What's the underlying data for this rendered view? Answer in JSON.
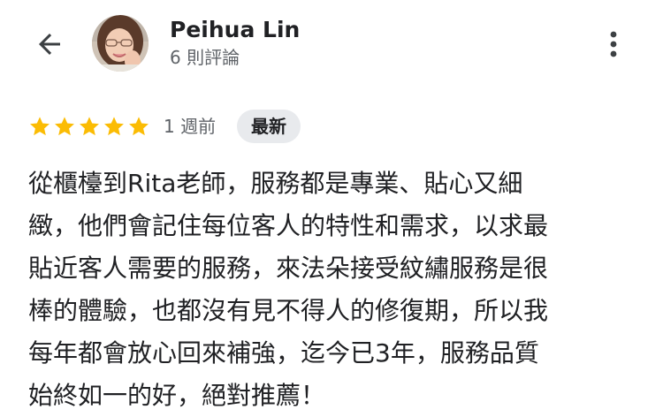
{
  "header": {
    "back_icon": "arrow-back-icon",
    "reviewer_name": "Peihua Lin",
    "review_count": "6 則評論",
    "more_icon": "more-vert-icon"
  },
  "review": {
    "rating": 5,
    "rating_max": 5,
    "star_color": "#fbbc04",
    "time": "1 週前",
    "badge": "最新",
    "lines": [
      "從櫃檯到Rita老師，服務都是專業、貼心又細",
      "緻，他們會記住每位客人的特性和需求，以求最",
      "貼近客人需要的服務，來法朵接受紋繡服務是很",
      "棒的體驗，也都沒有見不得人的修復期，所以我",
      "每年都會放心回來補強，迄今已3年，服務品質",
      "始終如一的好，絕對推薦！"
    ]
  },
  "colors": {
    "text_primary": "#202124",
    "text_secondary": "#5f6368",
    "badge_bg": "#e8eaed"
  }
}
